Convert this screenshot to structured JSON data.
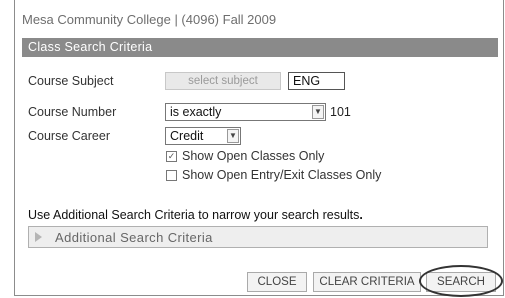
{
  "page": {
    "title": "Mesa Community College | (4096) Fall 2009"
  },
  "section": {
    "title": "Class Search Criteria"
  },
  "course_subject": {
    "label": "Course Subject",
    "select_button": "select subject",
    "value": "ENG"
  },
  "course_number": {
    "label": "Course Number",
    "operator": "is exactly",
    "value": "101"
  },
  "course_career": {
    "label": "Course Career",
    "value": "Credit"
  },
  "checkboxes": {
    "open_classes": {
      "label": "Show Open Classes Only",
      "checked": true,
      "mark": "✓"
    },
    "open_entry": {
      "label": "Show Open Entry/Exit Classes Only",
      "checked": false
    }
  },
  "info": {
    "text": "Use Additional Search Criteria to narrow your search results",
    "suffix": "."
  },
  "additional": {
    "label": "Additional Search Criteria"
  },
  "buttons": {
    "close": "CLOSE",
    "clear": "CLEAR CRITERIA",
    "search": "SEARCH"
  }
}
